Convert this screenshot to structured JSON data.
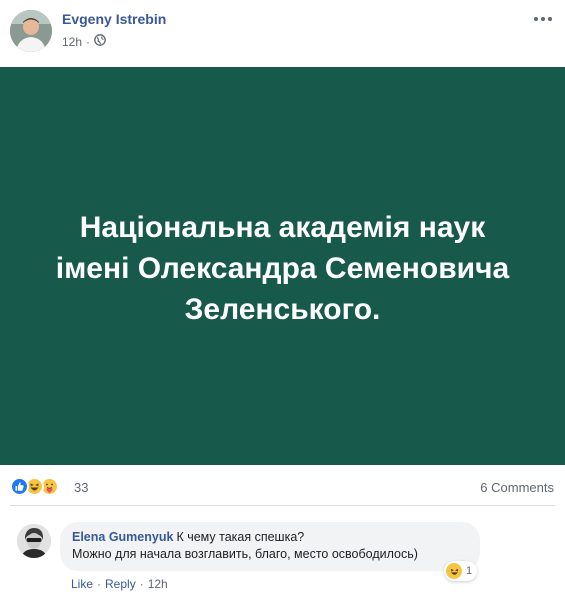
{
  "post": {
    "author": "Evgeny Istrebin",
    "time": "12h",
    "separator": "·",
    "privacy_icon": "globe-icon",
    "menu_icon": "more-horizontal-icon",
    "image_text": "Національна академія наук\nімені Олександра Семеновича\nЗеленського.",
    "image_bg": "#17594a"
  },
  "reactions": {
    "icons": [
      "like-icon",
      "haha-icon",
      "care-icon"
    ],
    "count": "33",
    "comments": "6 Comments"
  },
  "comment": {
    "author": "Elena Gumenyuk",
    "text": "К чему такая спешка?\nМожно для начала возглавить, благо, место освободилось)",
    "reaction_icon": "haha-icon",
    "reaction_count": "1",
    "like": "Like",
    "reply": "Reply",
    "separator": "·",
    "time": "12h"
  },
  "colors": {
    "link": "#385898",
    "meta": "#606770",
    "bubble": "#f2f3f5"
  }
}
